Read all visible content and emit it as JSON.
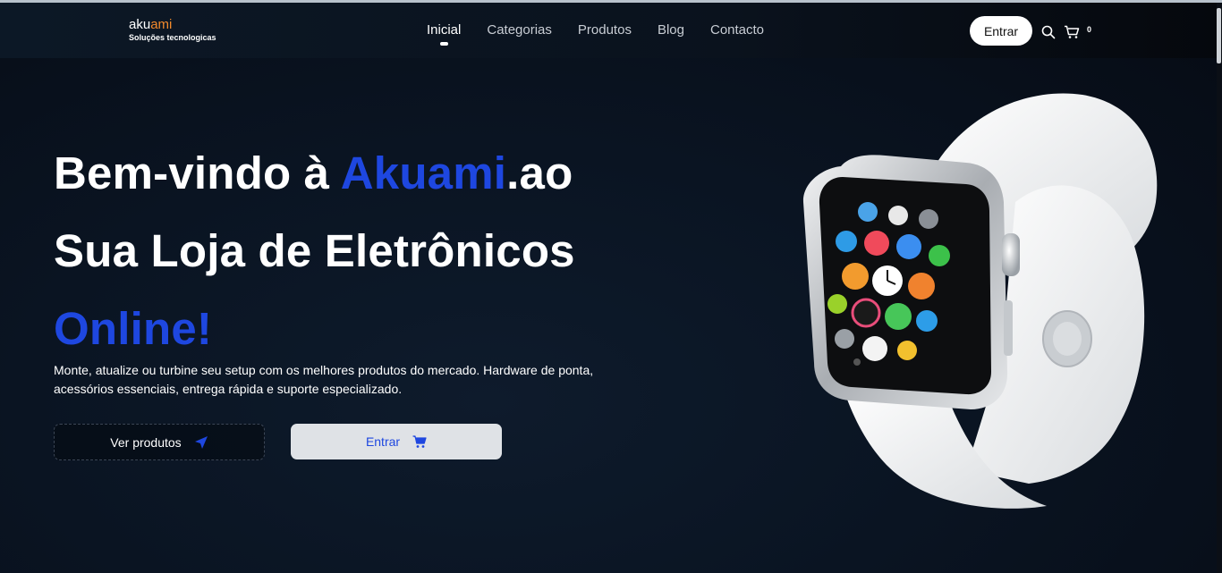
{
  "brand": {
    "name_main": "aku",
    "name_accent": "ami",
    "tagline": "Soluções tecnologicas"
  },
  "nav": {
    "items": [
      "Inicial",
      "Categorias",
      "Produtos",
      "Blog",
      "Contacto"
    ],
    "active": "Inicial"
  },
  "header": {
    "login_label": "Entrar",
    "cart_count": "0"
  },
  "hero": {
    "line1_prefix": "Bem-vindo à ",
    "line1_brand": "Akuami",
    "line1_suffix": ".ao",
    "line2": "Sua Loja de Eletrônicos",
    "line3": "Online!",
    "description": "Monte, atualize ou turbine seu setup com os melhores produtos do mercado. Hardware de ponta, acessórios essenciais, entrega rápida e suporte especializado.",
    "btn_products": "Ver produtos",
    "btn_enter": "Entrar"
  },
  "colors": {
    "accent_blue": "#1e47e0",
    "brand_orange": "#f2892c",
    "background": "#0a1422"
  },
  "icons": [
    "search-icon",
    "cart-icon",
    "send-icon",
    "shopping-cart-icon"
  ]
}
